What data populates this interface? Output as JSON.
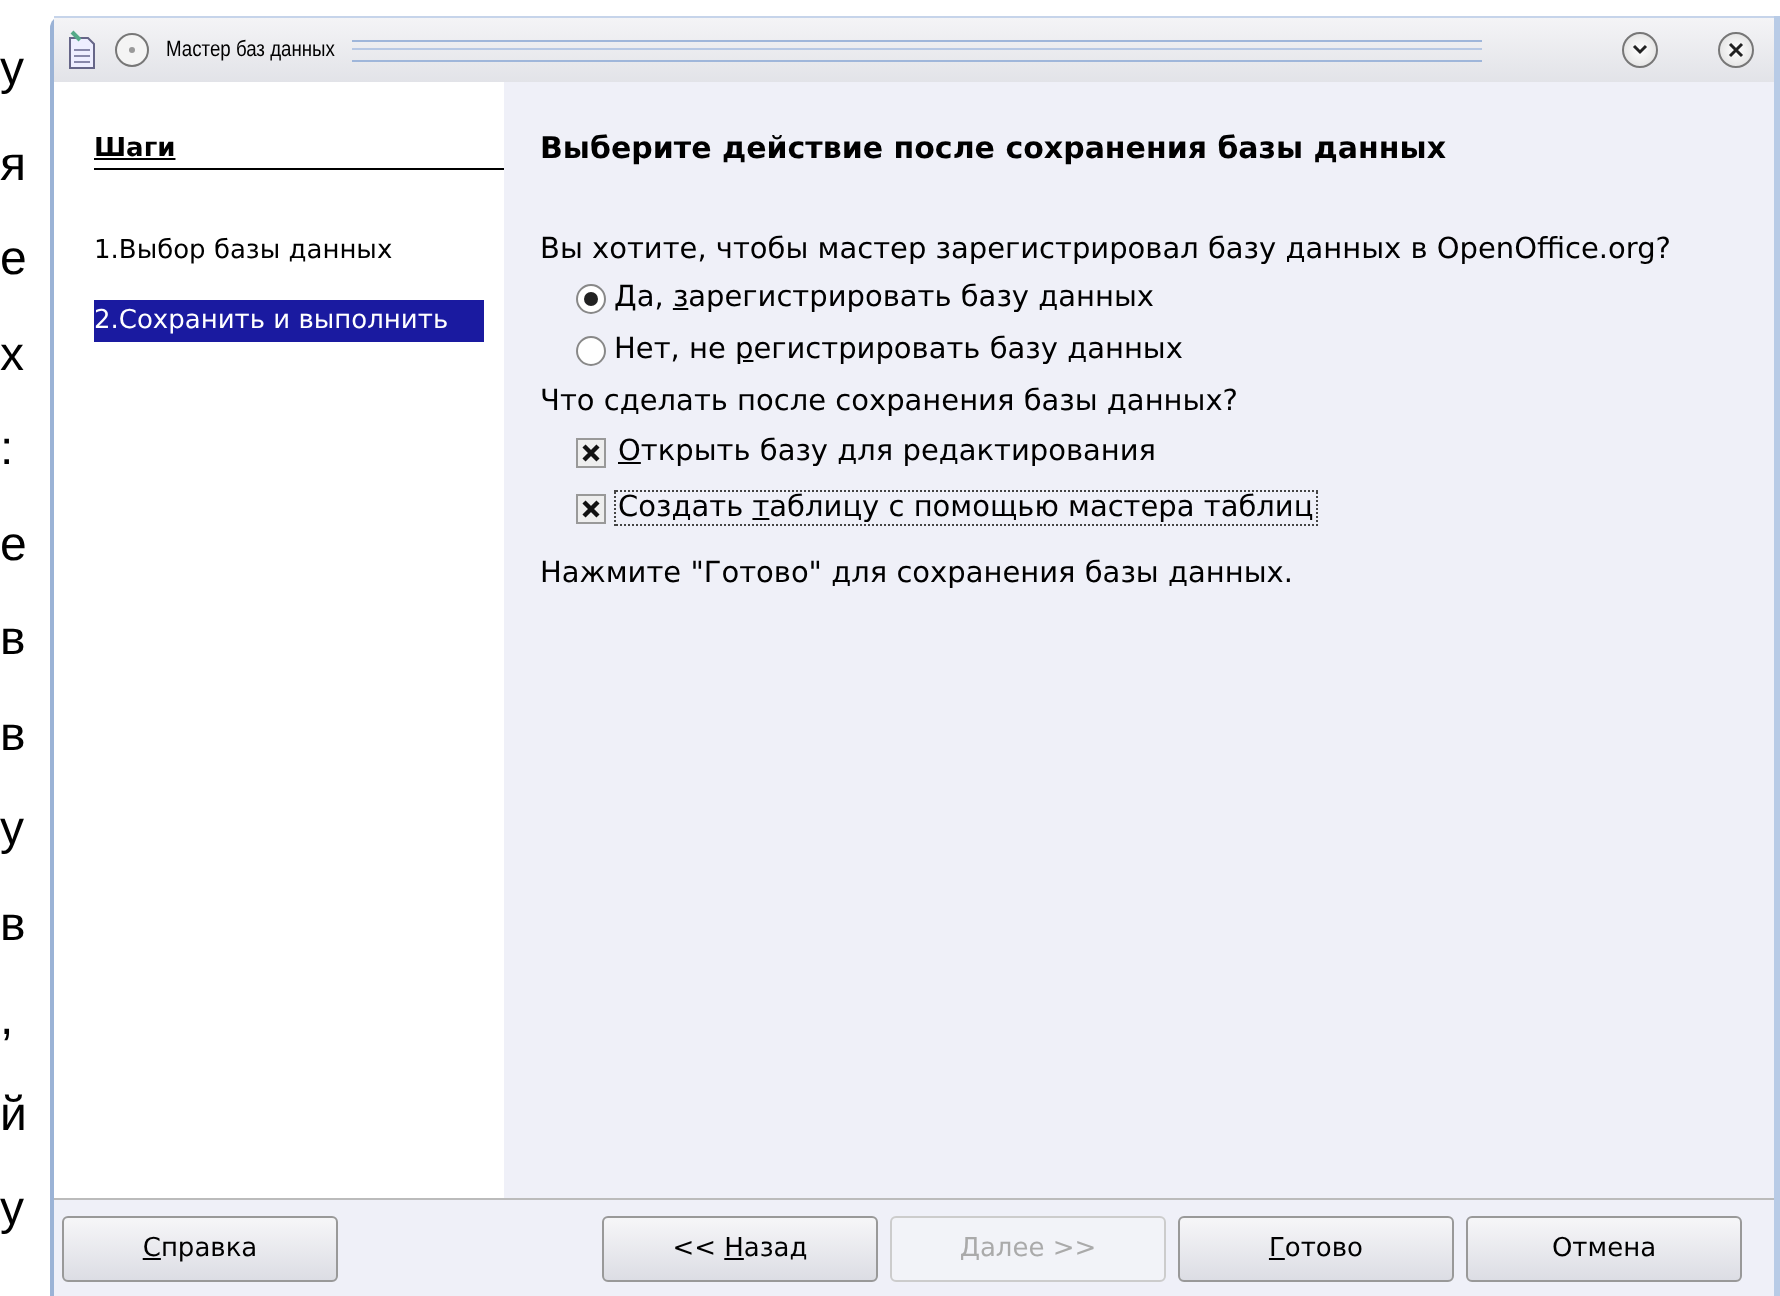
{
  "background_letters": [
    "у",
    "я",
    "е",
    "х",
    ":",
    "е",
    "в",
    "в",
    "у",
    "в",
    ",",
    "й",
    "у"
  ],
  "window": {
    "title": "Мастер баз данных"
  },
  "steps": {
    "heading": "Шаги",
    "items": [
      {
        "label": "1.Выбор базы данных",
        "selected": false
      },
      {
        "label": "2.Сохранить и выполнить",
        "selected": true
      }
    ]
  },
  "content": {
    "heading": "Выберите действие после сохранения базы данных",
    "register_question": "Вы хотите, чтобы мастер зарегистрировал базу данных в OpenOffice.org?",
    "register_options": [
      {
        "before": "Да, ",
        "key": "з",
        "after": "арегистрировать базу данных",
        "selected": true
      },
      {
        "before": "Нет, не ",
        "key": "р",
        "after": "егистрировать базу данных",
        "selected": false
      }
    ],
    "after_question": "Что сделать после сохранения базы данных?",
    "after_options": [
      {
        "key": "О",
        "after": "ткрыть базу для редактирования",
        "checked": true,
        "focused": false
      },
      {
        "before": "Создать ",
        "key": "т",
        "after": "аблицу с помощью мастера таблиц",
        "checked": true,
        "focused": true
      }
    ],
    "hint": "Нажмите \"Готово\" для сохранения базы данных."
  },
  "buttons": [
    {
      "kind": "help",
      "key": "С",
      "after": "правка",
      "disabled": false
    },
    {
      "kind": "nav",
      "before": "<< ",
      "key": "Н",
      "after": "азад",
      "disabled": false
    },
    {
      "kind": "nav",
      "key": "Д",
      "after": "алее >>",
      "disabled": true
    },
    {
      "kind": "nav",
      "key": "Г",
      "after": "отово",
      "disabled": false
    },
    {
      "kind": "nav",
      "after": "Отмена",
      "disabled": false
    }
  ]
}
